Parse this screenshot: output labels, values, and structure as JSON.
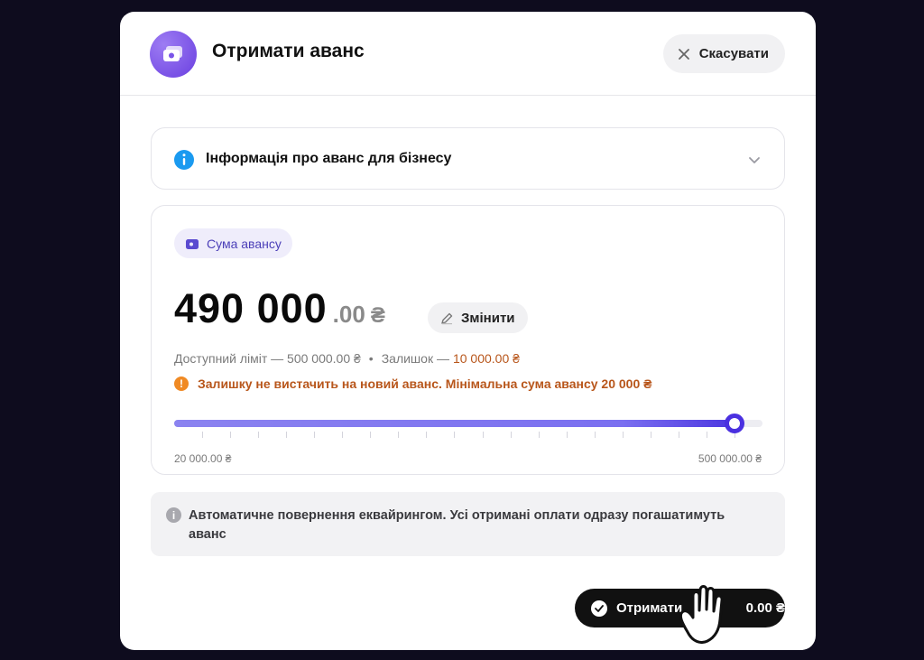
{
  "header": {
    "title": "Отримати аванс",
    "cancel_label": "Скасувати",
    "icon": "cash-icon"
  },
  "info_section": {
    "label": "Інформація про аванс для бізнесу",
    "icon": "info-icon",
    "expand_icon": "chevron-down-icon"
  },
  "amount": {
    "badge_label": "Сума авансу",
    "value_main": "490 000",
    "value_decimals": ".00",
    "currency": "₴",
    "edit_label": "Змінити",
    "available_limit_text": "Доступний ліміт — 500 000.00 ₴",
    "separator": "•",
    "balance_label": "Залишок —",
    "balance_value": "10 000.00 ₴",
    "warning": "Залишку не вистачить на новий аванс. Мінімальна сума авансу 20 000 ₴",
    "slider": {
      "min_label": "20 000.00 ₴",
      "max_label": "500 000.00 ₴",
      "min": 20000,
      "max": 500000,
      "value": 490000
    }
  },
  "auto_return_note": "Автоматичне повернення еквайрингом. Усі отримані оплати одразу погашатимуть аванс",
  "submit": {
    "label_visible_start": "Отримати",
    "label_visible_end": "0.00 ₴"
  },
  "colors": {
    "accent": "#4a30e0",
    "warning": "#b8561b",
    "badge_bg": "#efedfb"
  }
}
